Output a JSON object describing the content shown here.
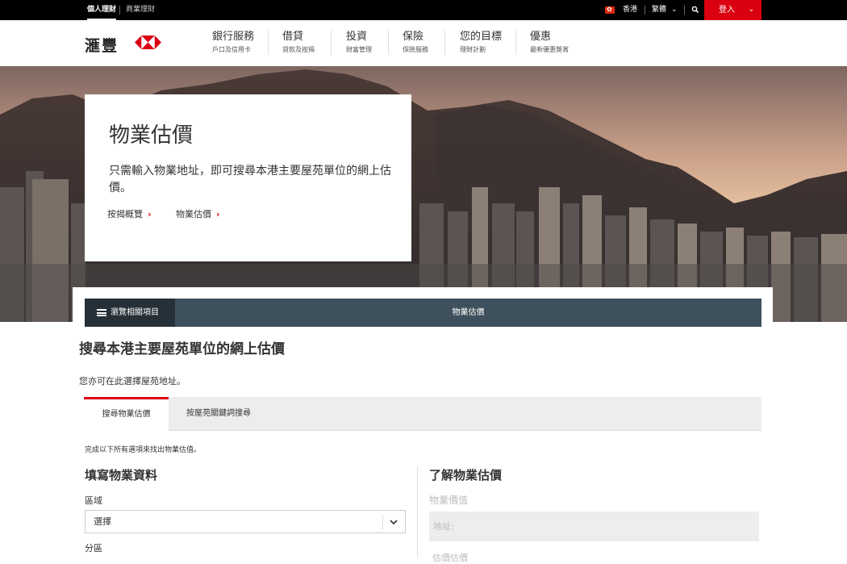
{
  "topbar": {
    "personal": "個人理財",
    "commercial": "商業理財",
    "region": "香港",
    "language": "繁體",
    "login": "登入"
  },
  "brand": {
    "name": "滙豐"
  },
  "nav": [
    {
      "main": "銀行服務",
      "sub": "戶口及信用卡"
    },
    {
      "main": "借貸",
      "sub": "貸款及按揭"
    },
    {
      "main": "投資",
      "sub": "財富管理"
    },
    {
      "main": "保險",
      "sub": "保險服務"
    },
    {
      "main": "您的目標",
      "sub": "理財計劃"
    },
    {
      "main": "優惠",
      "sub": "最新優惠獎賞"
    }
  ],
  "hero": {
    "title": "物業估價",
    "description": "只需輸入物業地址，即可搜尋本港主要屋苑單位的網上估價。",
    "link1": "按揭概覽",
    "link2": "物業估價"
  },
  "browse": {
    "toggle": "瀏覽相關項目",
    "current": "物業估價"
  },
  "section": {
    "title": "搜尋本港主要屋苑單位的網上估價",
    "hint": "您亦可在此選擇屋苑地址。"
  },
  "tabs": {
    "active": "搜尋物業估價",
    "other": "按屋苑關鍵詞搜尋"
  },
  "form": {
    "instruction": "完成以下所有選項來找出物業估值。",
    "title": "填寫物業資料",
    "district_label": "區域",
    "district_value": "選擇",
    "subdistrict_label": "分區"
  },
  "info": {
    "title": "了解物業估價",
    "value_label": "物業價值",
    "address_label": "地址:",
    "next_label": "估價估價"
  },
  "colors": {
    "brand_red": "#db0011",
    "bar_dark": "#3e505b",
    "bar_darker": "#253038"
  }
}
